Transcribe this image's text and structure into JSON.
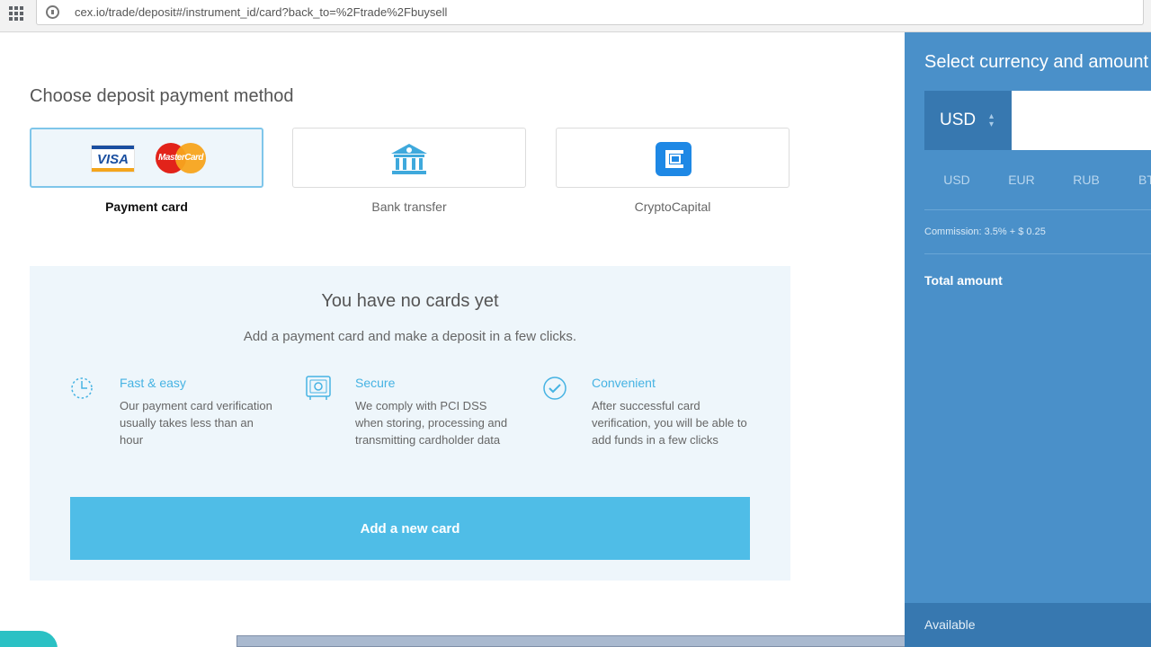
{
  "browser": {
    "url": "cex.io/trade/deposit#/instrument_id/card?back_to=%2Ftrade%2Fbuysell"
  },
  "deposit": {
    "title": "Choose deposit payment method",
    "methods": [
      {
        "label": "Payment card",
        "selected": true,
        "logos": [
          "VISA",
          "MasterCard"
        ]
      },
      {
        "label": "Bank transfer",
        "selected": false,
        "icon": "bank-icon"
      },
      {
        "label": "CryptoCapital",
        "selected": false,
        "icon": "cryptocapital-icon"
      }
    ]
  },
  "no_cards": {
    "title": "You have no cards yet",
    "subtitle": "Add a payment card and make a deposit in a few clicks.",
    "features": [
      {
        "title": "Fast & easy",
        "text": "Our payment card verification usually takes less than an hour",
        "icon": "clock-icon"
      },
      {
        "title": "Secure",
        "text": "We comply with PCI DSS when storing, processing and transmitting cardholder data",
        "icon": "safe-icon"
      },
      {
        "title": "Convenient",
        "text": "After successful card verification, you will be able to add funds in a few clicks",
        "icon": "check-circle-icon"
      }
    ],
    "add_button": "Add a new card"
  },
  "sidebar": {
    "title": "Select currency and amount",
    "selected_currency": "USD",
    "amount_value": "",
    "currency_tabs": [
      "USD",
      "EUR",
      "RUB",
      "BTC"
    ],
    "commission": "Commission: 3.5% + $ 0.25",
    "total_label": "Total amount",
    "available_label": "Available"
  },
  "colors": {
    "accent": "#4fbde7",
    "sidebar_bg": "#4a90c9",
    "sidebar_dark": "#3778b0",
    "panel_bg": "#eef6fb"
  }
}
